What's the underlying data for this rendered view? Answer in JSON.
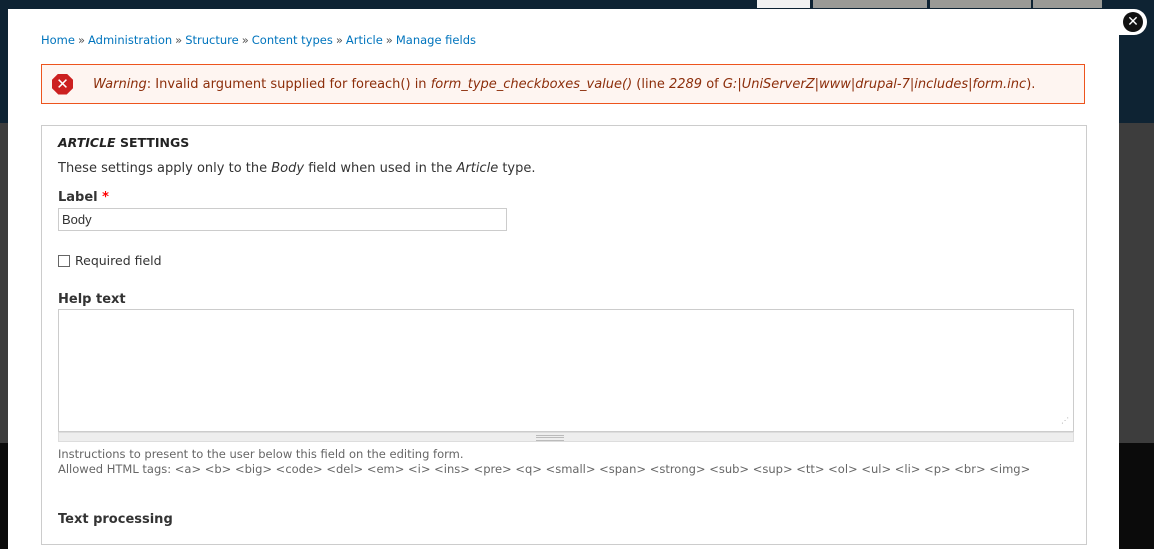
{
  "breadcrumb": [
    "Home",
    "Administration",
    "Structure",
    "Content types",
    "Article",
    "Manage fields"
  ],
  "breadcrumb_separator": "»",
  "close_glyph": "✕",
  "message": {
    "type": "error",
    "icon_glyph": "✕",
    "label": "Warning",
    "text1": ": Invalid argument supplied for foreach() in ",
    "function": "form_type_checkboxes_value()",
    "text2": " (line ",
    "line": "2289",
    "text3": " of ",
    "file": "G:|UniServerZ|www|drupal-7|includes|form.inc",
    "text4": ")."
  },
  "settings": {
    "legend_em": "ARTICLE",
    "legend_rest": " SETTINGS",
    "desc_1": "These settings apply only to the ",
    "desc_field": "Body",
    "desc_2": " field when used in the ",
    "desc_type": "Article",
    "desc_3": " type.",
    "label_label": "Label",
    "required_mark": "*",
    "label_value": "Body",
    "required_field_label": "Required field",
    "required_checked": false,
    "help_text_label": "Help text",
    "help_text_value": "",
    "help_desc": "Instructions to present to the user below this field on the editing form.",
    "allowed_tags": "Allowed HTML tags: <a> <b> <big> <code> <del> <em> <i> <ins> <pre> <q> <small> <span> <strong> <sub> <sup> <tt> <ol> <ul> <li> <p> <br> <img>",
    "text_processing_label": "Text processing"
  },
  "colors": {
    "link": "#0074bd",
    "error_border": "#ed541d",
    "error_bg": "#fef5f1",
    "error_text": "#8c2e0b",
    "header_bg": "#0e2333"
  }
}
